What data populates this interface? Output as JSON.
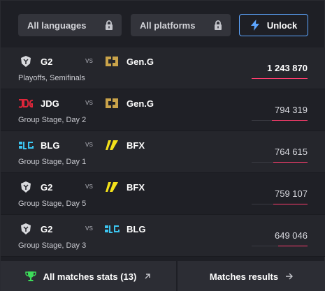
{
  "filters": {
    "languages_label": "All languages",
    "platforms_label": "All platforms",
    "unlock_label": "Unlock"
  },
  "matches": [
    {
      "team1": "G2",
      "team2": "Gen.G",
      "vs": "vs",
      "stage": "Playoffs, Semifinals",
      "viewers": "1 243 870",
      "share": 1.0,
      "team1_logo": "g2-logo-icon",
      "team2_logo": "geng-logo-icon"
    },
    {
      "team1": "JDG",
      "team2": "Gen.G",
      "vs": "vs",
      "stage": "Group Stage, Day 2",
      "viewers": "794 319",
      "share": 0.64,
      "team1_logo": "jdg-logo-icon",
      "team2_logo": "geng-logo-icon"
    },
    {
      "team1": "BLG",
      "team2": "BFX",
      "vs": "vs",
      "stage": "Group Stage, Day 1",
      "viewers": "764 615",
      "share": 0.61,
      "team1_logo": "blg-logo-icon",
      "team2_logo": "bfx-logo-icon"
    },
    {
      "team1": "G2",
      "team2": "BFX",
      "vs": "vs",
      "stage": "Group Stage, Day 5",
      "viewers": "759 107",
      "share": 0.61,
      "team1_logo": "g2-logo-icon",
      "team2_logo": "bfx-logo-icon"
    },
    {
      "team1": "G2",
      "team2": "BLG",
      "vs": "vs",
      "stage": "Group Stage, Day 3",
      "viewers": "649 046",
      "share": 0.52,
      "team1_logo": "g2-logo-icon",
      "team2_logo": "blg-logo-icon"
    }
  ],
  "footer": {
    "stats_label": "All matches stats (13)",
    "results_label": "Matches results"
  },
  "colors": {
    "accent_blue": "#5da6ff",
    "bar_pink": "#ff3d6e",
    "trophy_green": "#3ddc5a"
  }
}
